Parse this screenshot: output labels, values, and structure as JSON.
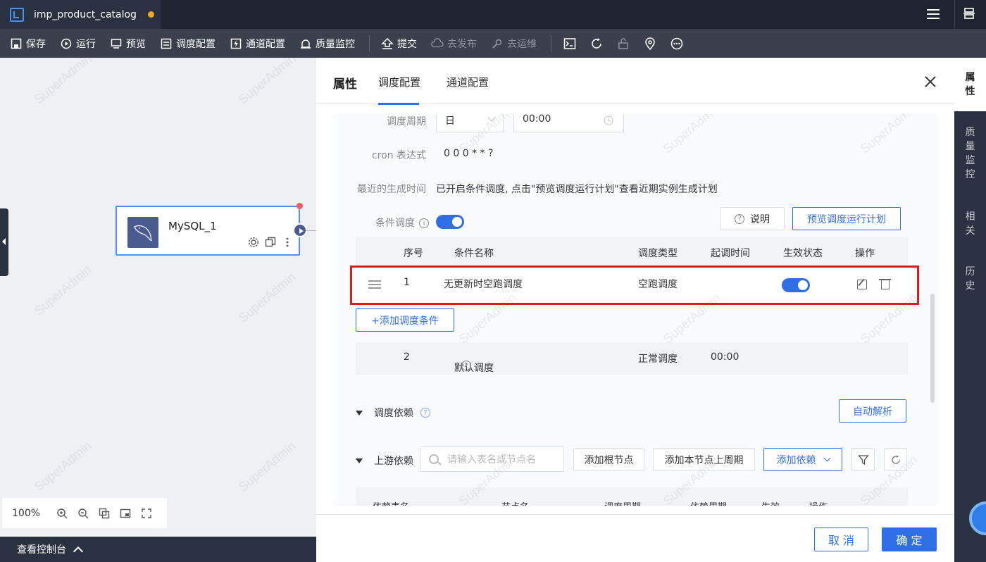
{
  "titlebar": {
    "file_name": "imp_product_catalog",
    "unsaved_indicator_color": "#f5a623"
  },
  "toolbar": {
    "save": "保存",
    "run": "运行",
    "preview": "预览",
    "schedule_config": "调度配置",
    "channel_config": "通道配置",
    "quality_monitor": "质量监控",
    "submit": "提交",
    "publish": "去发布",
    "ops": "去运维"
  },
  "canvas": {
    "node_title": "MySQL_1",
    "zoom": "100%",
    "console": "查看控制台"
  },
  "panel": {
    "title": "属性",
    "tabs": [
      "调度配置",
      "通道配置"
    ],
    "active_tab": "调度配置",
    "schedule_period_label": "调度周期",
    "schedule_period_value": "日",
    "schedule_time_value": "00:00",
    "cron_label": "cron 表达式",
    "cron_value": "0 0 0 * * ?",
    "recent_gen_label": "最近的生成时间",
    "recent_gen_value": "已开启条件调度, 点击\"预览调度运行计划\"查看近期实例生成计划",
    "conditional_label": "条件调度",
    "conditional_enabled": true,
    "explain_button": "说明",
    "preview_plan_button": "预览调度运行计划",
    "condition_table": {
      "headers": [
        "序号",
        "条件名称",
        "调度类型",
        "起调时间",
        "生效状态",
        "操作"
      ],
      "rows": [
        {
          "index": "1",
          "name": "无更新时空跑调度",
          "type": "空跑调度",
          "start_time": "",
          "enabled": true
        }
      ],
      "add_button": "+添加调度条件",
      "default_row": {
        "index": "2",
        "name": "默认调度",
        "type": "正常调度",
        "start_time": "00:00"
      }
    },
    "dependency_title": "调度依赖",
    "auto_parse_button": "自动解析",
    "upstream_title": "上游依赖",
    "upstream_search_placeholder": "请输入表名或节点名",
    "add_root_button": "添加根节点",
    "add_prev_period_button": "添加本节点上周期",
    "add_dependency_button": "添加依赖",
    "dep_table_headers": [
      "依赖表名",
      "节点名",
      "调度周期",
      "依赖周期",
      "生效",
      "操作"
    ],
    "cancel_button": "取 消",
    "confirm_button": "确 定"
  },
  "right_bar": {
    "items": [
      "属性",
      "质量监控",
      "相关",
      "历史"
    ],
    "active": "属性"
  },
  "colors": {
    "accent": "#2f6fe5",
    "highlight": "#e0191e",
    "dark_bg": "#2a3140"
  },
  "watermark": "SuperAdmin"
}
